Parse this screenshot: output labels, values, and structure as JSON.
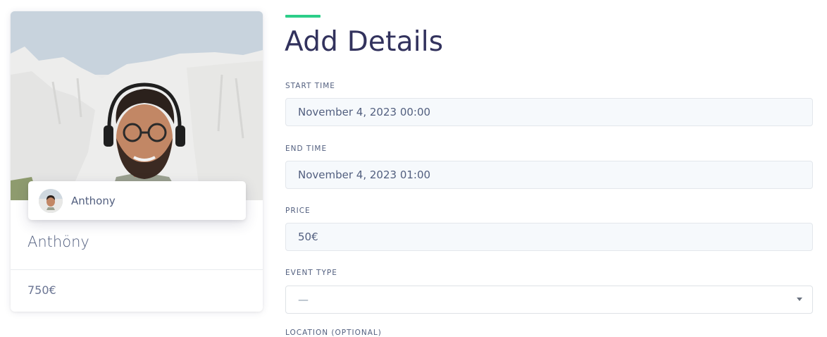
{
  "card": {
    "chip_name": "Anthony",
    "title": "Anthöny",
    "price": "750€"
  },
  "form": {
    "title": "Add Details",
    "start_time": {
      "label": "START TIME",
      "value": "November 4, 2023 00:00"
    },
    "end_time": {
      "label": "END TIME",
      "value": "November 4, 2023 01:00"
    },
    "price": {
      "label": "PRICE",
      "value": "50€"
    },
    "event_type": {
      "label": "EVENT TYPE",
      "value": "—"
    },
    "next_label": "LOCATION (OPTIONAL)"
  },
  "colors": {
    "accent": "#2dce89",
    "heading": "#32325d",
    "text": "#525f7f",
    "field_bg": "#f6f9fc"
  },
  "icons": {
    "select_caret": "caret-down-icon"
  }
}
